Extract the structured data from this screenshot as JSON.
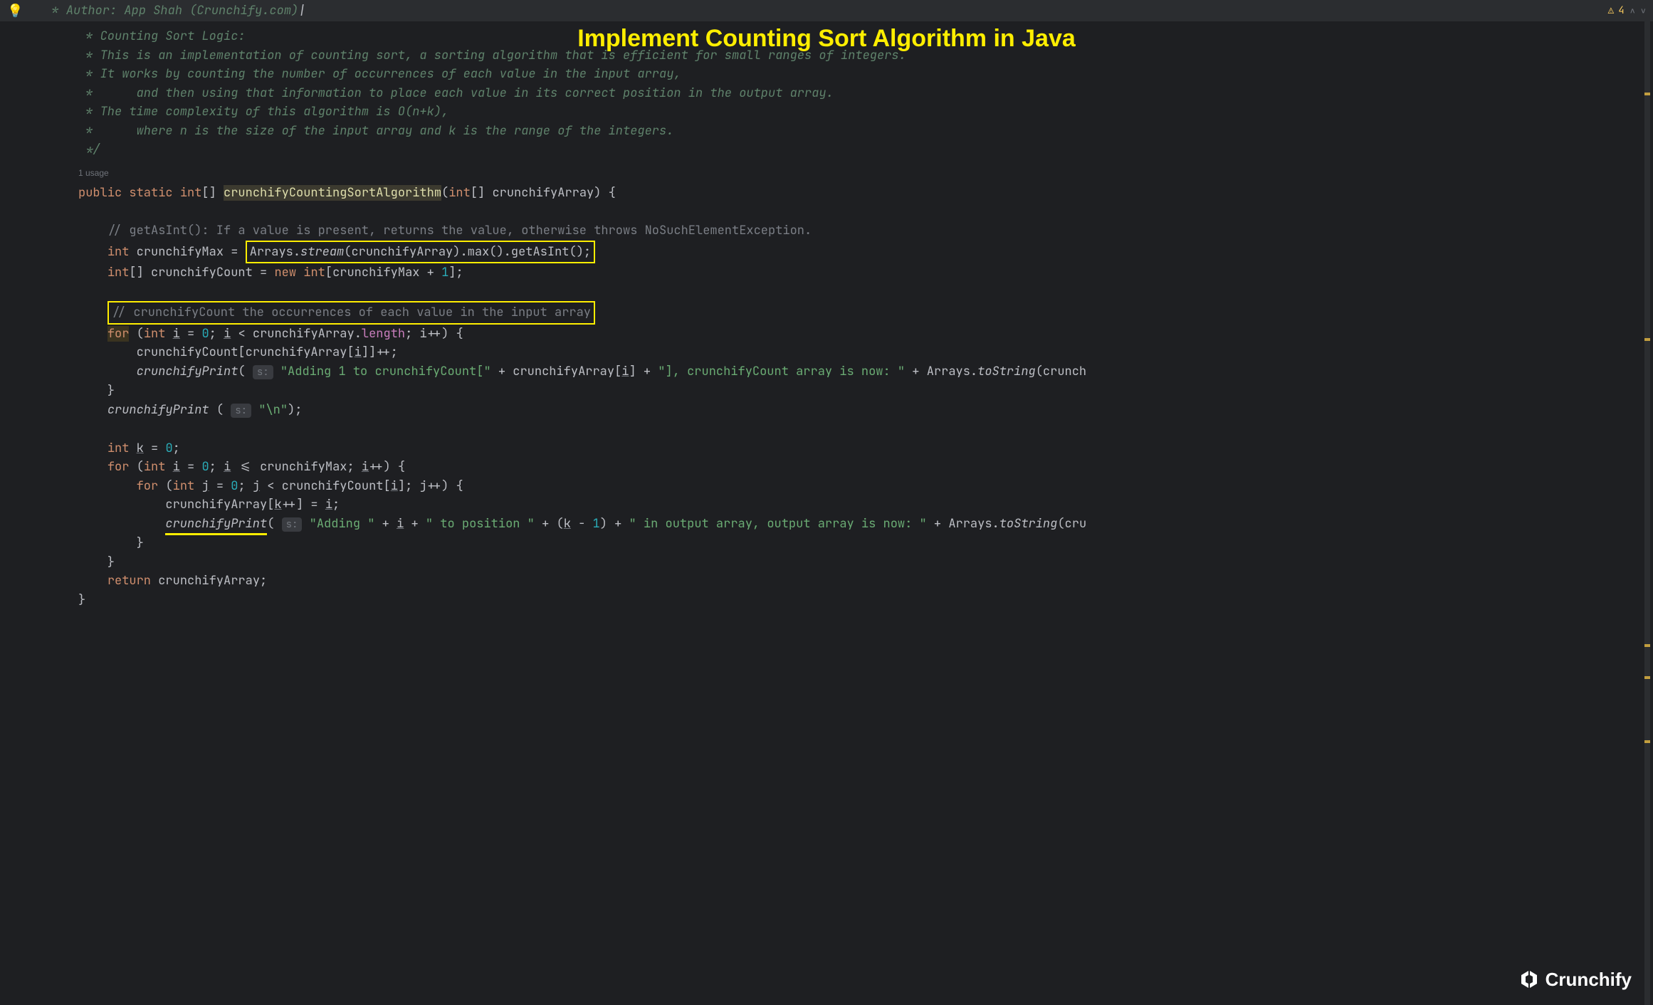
{
  "topbar": {
    "comment_line": " * Author: App Shah (Crunchify.com)",
    "warning_count": "4"
  },
  "title": "Implement Counting Sort Algorithm in Java",
  "comments": {
    "l1": " * Counting Sort Logic:",
    "l2": " * This is an implementation of counting sort, a sorting algorithm that is efficient for small ranges of integers.",
    "l3": " * It works by counting the number of occurrences of each value in the input array,",
    "l4": " *      and then using that information to place each value in its correct position in the output array.",
    "l5": " * The time complexity of this algorithm is O(n+k),",
    "l6": " *      where n is the size of the input array and k is the range of the integers.",
    "l7": " */"
  },
  "usages_label": "1 usage",
  "code": {
    "sig_public": "public",
    "sig_static": "static",
    "sig_int_arr": "int",
    "method_name": "crunchifyCountingSortAlgorithm",
    "param_type": "int",
    "param_name": "crunchifyArray",
    "comment_getasint": "// getAsInt(): If a value is present, returns the value, otherwise throws NoSuchElementException.",
    "max_var": "crunchifyMax",
    "arrays_cls": "Arrays",
    "stream_m": "stream",
    "max_m": "max",
    "getasint_m": "getAsInt",
    "count_var": "crunchifyCount",
    "new_kw": "new",
    "plus_one": "1",
    "comment_count_occ": "// crunchifyCount the occurrences of each value in the input array",
    "for_kw": "for",
    "int_kw": "int",
    "i_var": "i",
    "zero": "0",
    "length_f": "length",
    "print_m": "crunchifyPrint",
    "hint_s": "s:",
    "str_adding1": "\"Adding 1 to crunchifyCount[\"",
    "str_bracket_end": "\"], crunchifyCount array is now: \"",
    "tostring_m": "toString",
    "tostring_arg_trunc": "(crunch",
    "newline_str": "\"\\n\"",
    "k_var": "k",
    "j_var": "j",
    "str_adding": "\"Adding \"",
    "str_to_pos": "\" to position \"",
    "str_output": "\" in output array, output array is now: \"",
    "tostring_arg_trunc2": "(cru",
    "return_kw": "return"
  },
  "logo_text": "Crunchify"
}
